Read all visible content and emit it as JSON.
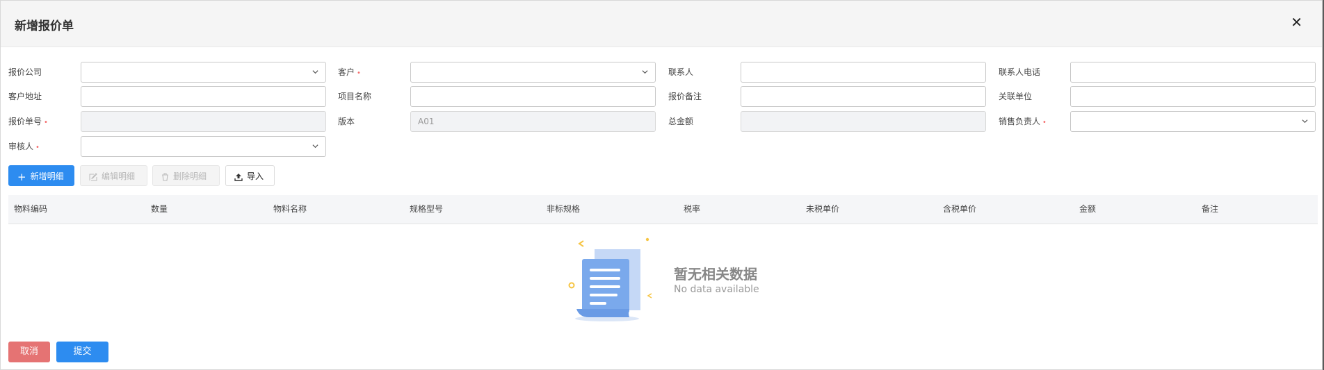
{
  "dialog": {
    "title": "新增报价单"
  },
  "form": {
    "company": {
      "label": "报价公司",
      "value": ""
    },
    "customer": {
      "label": "客户",
      "value": ""
    },
    "contact": {
      "label": "联系人",
      "value": ""
    },
    "contact_phone": {
      "label": "联系人电话",
      "value": ""
    },
    "customer_address": {
      "label": "客户地址",
      "value": ""
    },
    "project_name": {
      "label": "项目名称",
      "value": ""
    },
    "quote_remark": {
      "label": "报价备注",
      "value": ""
    },
    "related_unit": {
      "label": "关联单位",
      "value": ""
    },
    "quote_no": {
      "label": "报价单号",
      "value": ""
    },
    "version": {
      "label": "版本",
      "value": "A01"
    },
    "total_amount": {
      "label": "总金额",
      "value": ""
    },
    "sales_owner": {
      "label": "销售负责人",
      "value": ""
    },
    "reviewer": {
      "label": "审核人",
      "value": ""
    },
    "required_mark": "•"
  },
  "toolbar": {
    "add_label": "新增明细",
    "edit_label": "编辑明细",
    "delete_label": "删除明细",
    "import_label": "导入"
  },
  "table": {
    "columns": [
      "物料编码",
      "数量",
      "物料名称",
      "规格型号",
      "非标规格",
      "税率",
      "未税单价",
      "含税单价",
      "金额",
      "备注"
    ],
    "empty_title": "暂无相关数据",
    "empty_subtitle": "No data available"
  },
  "footer": {
    "cancel_label": "取消",
    "submit_label": "提交"
  },
  "colors": {
    "primary": "#2d8cf0",
    "danger": "#e57373",
    "required": "#f56c6c",
    "illustration": "#7aa9ec"
  }
}
